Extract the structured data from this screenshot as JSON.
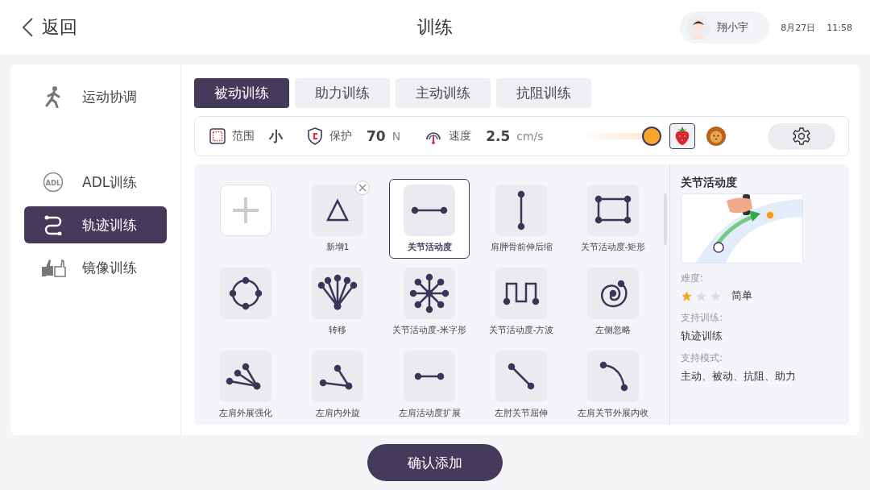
{
  "topbar": {
    "back": "返回",
    "title": "训练",
    "user": "翔小宇",
    "date": "8月27日",
    "time": "11:58"
  },
  "sidebar": {
    "items": [
      {
        "kind": "run",
        "label": "运动协调",
        "selected": false
      },
      {
        "kind": "adl",
        "icon_text": "ADL",
        "label": "ADL训练",
        "selected": false
      },
      {
        "kind": "track",
        "label": "轨迹训练",
        "selected": true
      },
      {
        "kind": "mirror",
        "label": "镜像训练",
        "selected": false
      }
    ]
  },
  "tabs": [
    {
      "label": "被动训练",
      "selected": true
    },
    {
      "label": "助力训练",
      "selected": false
    },
    {
      "label": "主动训练",
      "selected": false
    },
    {
      "label": "抗阻训练",
      "selected": false
    }
  ],
  "settings": {
    "range": {
      "label": "范围",
      "value": "小"
    },
    "protect": {
      "label": "保护",
      "value": "70",
      "unit": "N"
    },
    "speed": {
      "label": "速度",
      "value": "2.5",
      "unit": "cm/s"
    },
    "slider": {
      "level": 1
    },
    "themes": [
      {
        "kind": "strawberry",
        "selected": true
      },
      {
        "kind": "lion",
        "selected": false
      }
    ]
  },
  "grid": {
    "items": [
      {
        "kind": "add",
        "selected": false,
        "deletable": false
      },
      {
        "kind": "triangle",
        "label": "新增1",
        "selected": false,
        "deletable": true
      },
      {
        "kind": "line",
        "label": "关节活动度",
        "selected": true,
        "deletable": false
      },
      {
        "kind": "vline",
        "label": "肩胛骨前伸后缩",
        "selected": false,
        "deletable": false
      },
      {
        "kind": "rect",
        "label": "关节活动度-矩形",
        "selected": false,
        "deletable": false
      },
      {
        "kind": "circle",
        "selected": false,
        "deletable": false
      },
      {
        "kind": "fan",
        "label": "转移",
        "selected": false,
        "deletable": false
      },
      {
        "kind": "star",
        "label": "关节活动度-米字形",
        "selected": false,
        "deletable": false
      },
      {
        "kind": "wave",
        "label": "关节活动度-方波",
        "selected": false,
        "deletable": false
      },
      {
        "kind": "spiral",
        "label": "左侧忽略",
        "selected": false,
        "deletable": false
      },
      {
        "kind": "fan3",
        "label": "左肩外展强化",
        "selected": false,
        "deletable": false
      },
      {
        "kind": "angle",
        "label": "左肩内外旋",
        "selected": false,
        "deletable": false
      },
      {
        "kind": "short",
        "label": "左肩活动度扩展",
        "selected": false,
        "deletable": false
      },
      {
        "kind": "diag",
        "label": "左肘关节屈伸",
        "selected": false,
        "deletable": false
      },
      {
        "kind": "arc",
        "label": "左肩关节外展内收",
        "selected": false,
        "deletable": false
      }
    ]
  },
  "detail": {
    "title": "关节活动度",
    "difficulty_label": "难度:",
    "stars": 1,
    "difficulty": "简单",
    "training_label": "支持训练:",
    "training": "轨迹训练",
    "modes_label": "支持模式:",
    "modes": "主动、被动、抗阻、助力"
  },
  "confirm": "确认添加"
}
